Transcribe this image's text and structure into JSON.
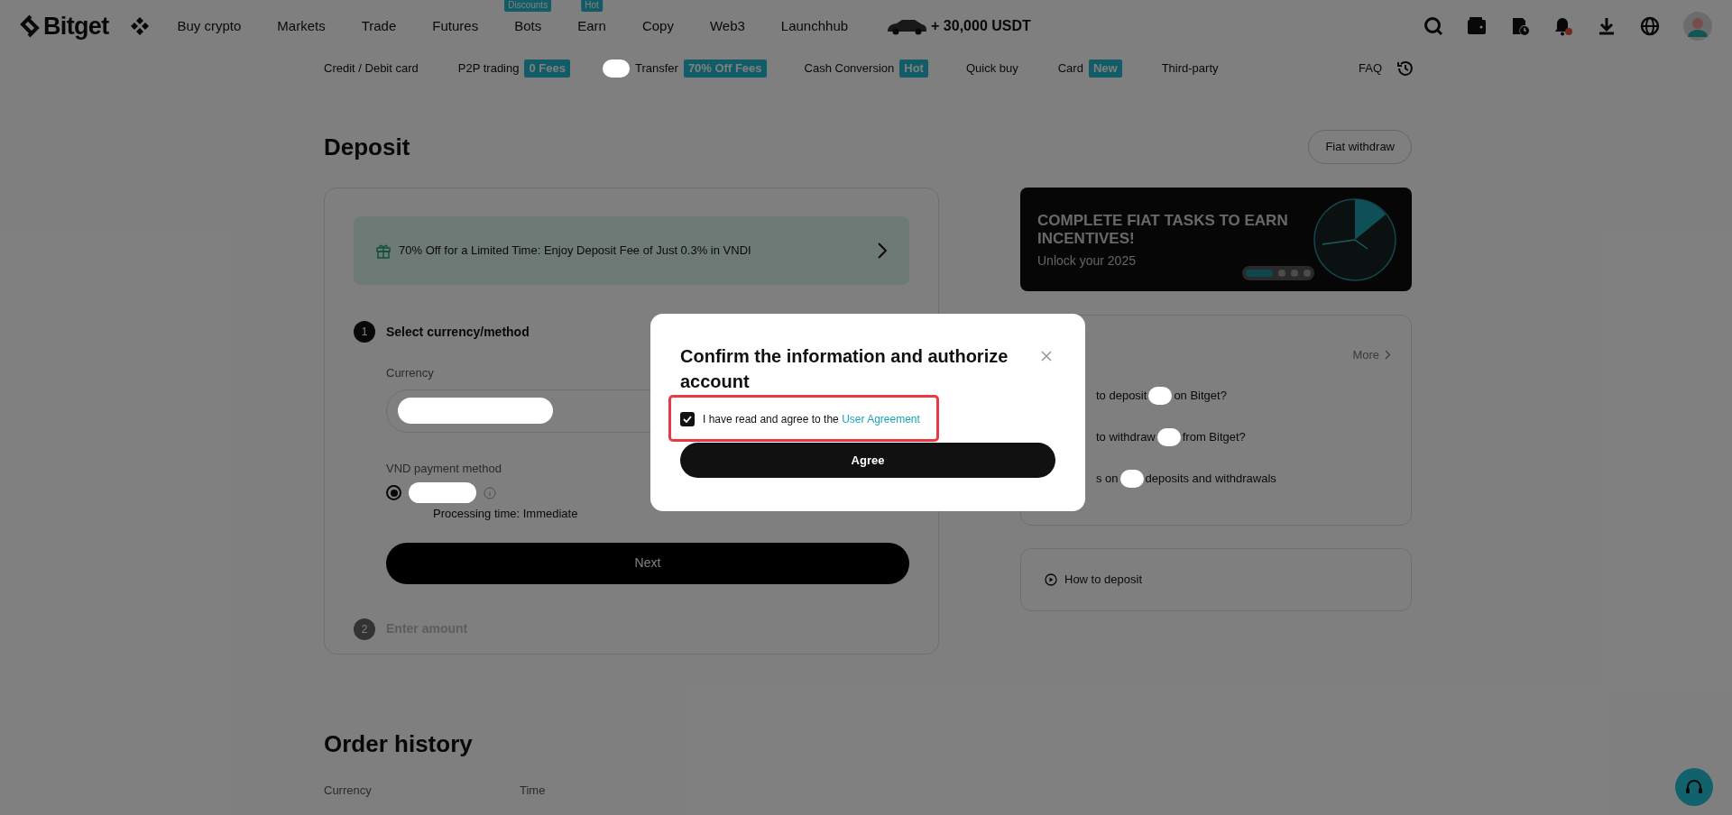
{
  "nav": {
    "logo": "Bitget",
    "items": [
      {
        "label": "Buy crypto"
      },
      {
        "label": "Markets"
      },
      {
        "label": "Trade"
      },
      {
        "label": "Futures"
      },
      {
        "label": "Bots",
        "badge": "Discounts"
      },
      {
        "label": "Earn",
        "badge": "Hot"
      },
      {
        "label": "Copy"
      },
      {
        "label": "Web3"
      },
      {
        "label": "Launchhub"
      }
    ],
    "promo": "+ 30,000 USDT"
  },
  "subnav": {
    "items": [
      {
        "label": "Credit / Debit card"
      },
      {
        "label": "P2P trading",
        "badge": "0 Fees"
      },
      {
        "label": "Transfer",
        "badge": "70% Off Fees",
        "redacted_prefix": true
      },
      {
        "label": "Cash Conversion",
        "badge": "Hot"
      },
      {
        "label": "Quick buy"
      },
      {
        "label": "Card",
        "badge": "New"
      },
      {
        "label": "Third-party"
      }
    ],
    "faq": "FAQ"
  },
  "deposit": {
    "title": "Deposit",
    "fiat_withdraw": "Fiat withdraw",
    "promo_banner": "70% Off for a Limited Time: Enjoy Deposit Fee of Just 0.3% in VNDI",
    "steps": [
      {
        "number": "1",
        "title": "Select currency/method",
        "active": true
      },
      {
        "number": "2",
        "title": "Enter amount",
        "active": false
      }
    ],
    "currency_label": "Currency",
    "payment_method_label": "VND payment method",
    "payment_option": {
      "selected": true
    },
    "processing_time": "Processing time: Immediate",
    "next_button": "Next"
  },
  "banner": {
    "title": "COMPLETE FIAT TASKS TO EARN INCENTIVES!",
    "subtitle": "Unlock your 2025",
    "slides": [
      {
        "selected": true
      },
      {
        "selected": false
      },
      {
        "selected": false
      },
      {
        "selected": false
      }
    ]
  },
  "faq": {
    "more": "More",
    "items": [
      {
        "before": "to deposit",
        "after": "on Bitget?"
      },
      {
        "before": "to withdraw",
        "after": "from Bitget?"
      },
      {
        "before": "s on",
        "after": "deposits and withdrawals"
      }
    ]
  },
  "how_to_deposit": "How to deposit",
  "order_history": {
    "title": "Order history",
    "columns": [
      "Currency",
      "Time"
    ]
  },
  "modal": {
    "title": "Confirm the information and authorize account",
    "checkbox": {
      "checked": true,
      "label": "I have read and agree to the",
      "link": "User Agreement"
    },
    "agree_button": "Agree"
  }
}
